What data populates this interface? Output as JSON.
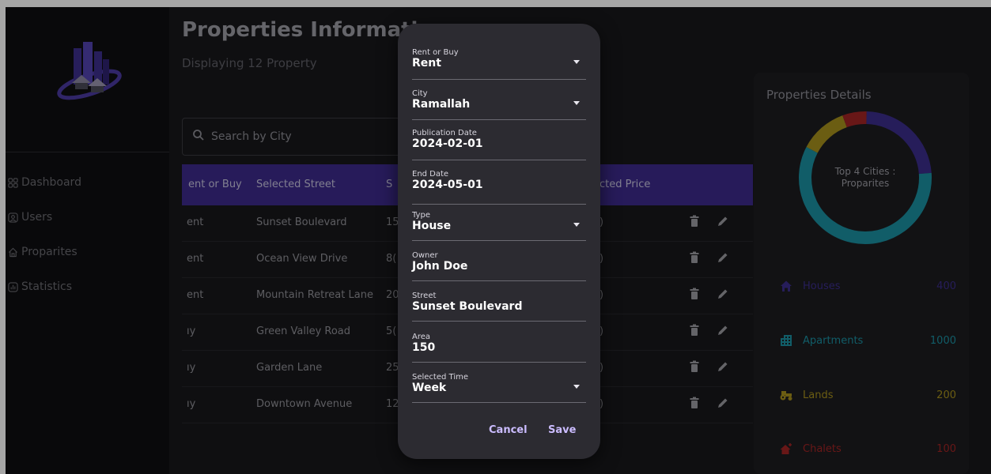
{
  "sidebar": {
    "items": [
      {
        "label": "Dashboard",
        "icon": "grid-icon"
      },
      {
        "label": "Users",
        "icon": "users-icon"
      },
      {
        "label": "Proparites",
        "icon": "home-icon"
      },
      {
        "label": "Statistics",
        "icon": "chart-icon"
      }
    ]
  },
  "main": {
    "title": "Properties Information",
    "subtitle": "Displaying 12 Property",
    "search_placeholder": "Search by City",
    "table": {
      "headers": [
        "ent or Buy",
        "Selected Street",
        "S",
        "cted Price"
      ],
      "rows": [
        {
          "rent": "ent",
          "street": "Sunset Boulevard",
          "s": "15",
          "price": ")"
        },
        {
          "rent": "ent",
          "street": "Ocean View Drive",
          "s": "8(",
          "price": ")"
        },
        {
          "rent": "ent",
          "street": "Mountain Retreat Lane",
          "s": "20",
          "price": ")"
        },
        {
          "rent": "ıy",
          "street": "Green Valley Road",
          "s": "5(",
          "price": ")"
        },
        {
          "rent": "ıy",
          "street": "Garden Lane",
          "s": "25",
          "price": ")"
        },
        {
          "rent": "ıy",
          "street": "Downtown Avenue",
          "s": "12",
          "price": ")"
        }
      ]
    }
  },
  "details": {
    "title": "Properties Details",
    "donut_label_1": "Top 4 Cities :",
    "donut_label_2": "Proparites",
    "stats": [
      {
        "label": "Houses",
        "value": "400",
        "color": "#3b2d8a",
        "icon": "house-icon"
      },
      {
        "label": "Apartments",
        "value": "1000",
        "color": "#1b8fa0",
        "icon": "apartment-icon"
      },
      {
        "label": "Lands",
        "value": "200",
        "color": "#a58f1c",
        "icon": "tractor-icon"
      },
      {
        "label": "Chalets",
        "value": "100",
        "color": "#a02424",
        "icon": "chalet-icon"
      }
    ],
    "chart_data": {
      "type": "pie",
      "categories": [
        "Houses",
        "Apartments",
        "Lands",
        "Chalets"
      ],
      "values": [
        400,
        1000,
        200,
        100
      ],
      "colors": [
        "#3b2d8a",
        "#1b8fa0",
        "#a58f1c",
        "#a02424"
      ]
    }
  },
  "dialog": {
    "fields": [
      {
        "label": "Rent or Buy",
        "value": "Rent",
        "dropdown": true
      },
      {
        "label": "City",
        "value": "Ramallah",
        "dropdown": true
      },
      {
        "label": "Publication Date",
        "value": "2024-02-01",
        "dropdown": false
      },
      {
        "label": "End Date",
        "value": "2024-05-01",
        "dropdown": false
      },
      {
        "label": "Type",
        "value": "House",
        "dropdown": true
      },
      {
        "label": "Owner",
        "value": "John Doe",
        "dropdown": false
      },
      {
        "label": "Street",
        "value": "Sunset Boulevard",
        "dropdown": false
      },
      {
        "label": "Area",
        "value": "150",
        "dropdown": false
      },
      {
        "label": "Selected Time",
        "value": "Week",
        "dropdown": true
      }
    ],
    "cancel_label": "Cancel",
    "save_label": "Save"
  }
}
